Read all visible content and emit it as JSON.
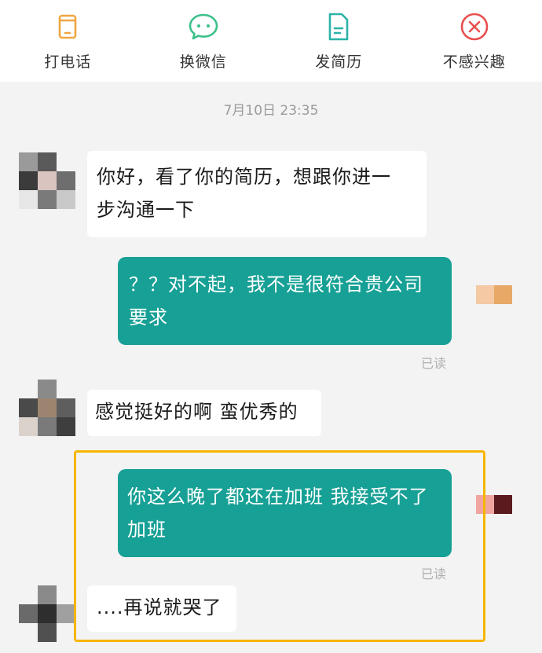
{
  "toolbar": {
    "items": [
      {
        "label": "打电话",
        "icon": "phone-icon",
        "color": "#f0a640"
      },
      {
        "label": "换微信",
        "icon": "wechat-icon",
        "color": "#3cc08a"
      },
      {
        "label": "发简历",
        "icon": "resume-icon",
        "color": "#2bb3a8"
      },
      {
        "label": "不感兴趣",
        "icon": "not-interested-icon",
        "color": "#e8504f"
      }
    ]
  },
  "chat": {
    "timestamp": "7月10日 23:35",
    "messages": [
      {
        "from": "recruiter",
        "lines": [
          "你好，看了你的简历，想跟你进一",
          "步沟通一下"
        ]
      },
      {
        "from": "me",
        "lines": [
          "？？对不起，我不是很符合贵公司",
          "要求"
        ],
        "status": "已读"
      },
      {
        "from": "recruiter",
        "lines": [
          "感觉挺好的啊 蛮优秀的"
        ]
      },
      {
        "from": "me",
        "lines": [
          "你这么晚了都还在加班 我接受不了",
          "加班"
        ],
        "status": "已读"
      },
      {
        "from": "recruiter",
        "lines": [
          "....再说就哭了"
        ]
      }
    ]
  },
  "colors": {
    "outgoing_bubble": "#17a095",
    "highlight_border": "#f7b500"
  }
}
